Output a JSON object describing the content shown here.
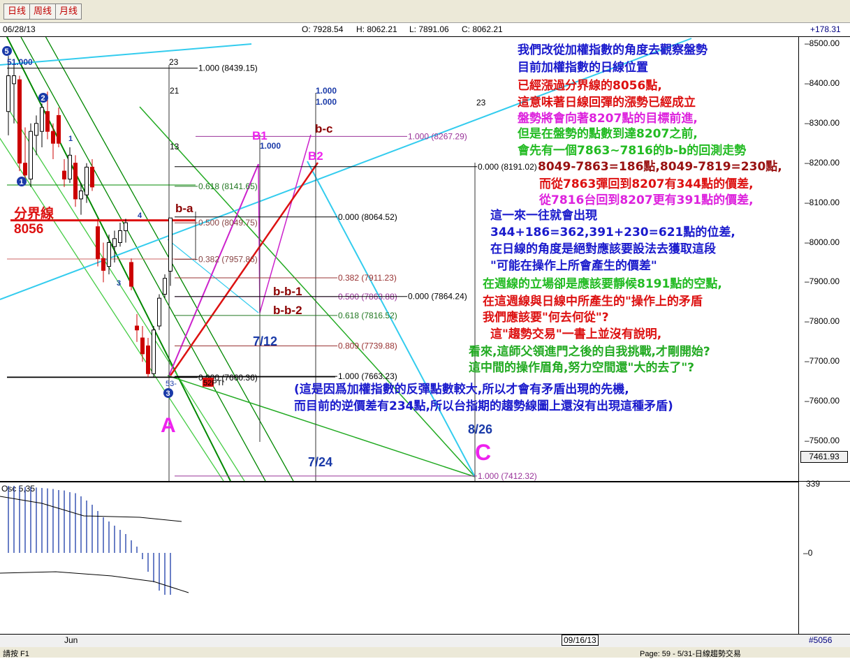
{
  "tabs": [
    {
      "label": "日线"
    },
    {
      "label": "周线"
    },
    {
      "label": "月线"
    }
  ],
  "header": {
    "date": "06/28/13",
    "open": "O: 7928.54",
    "high": "H: 8062.21",
    "low": "L: 7891.06",
    "close": "C: 8062.21",
    "change": "+178.31"
  },
  "price_axis": {
    "ticks": [
      "8500.00",
      "8400.00",
      "8300.00",
      "8200.00",
      "8100.00",
      "8000.00",
      "7900.00",
      "7800.00",
      "7700.00",
      "7600.00",
      "7500.00"
    ],
    "last_price": "7461.93"
  },
  "osc": {
    "label": "Osc 5,35",
    "axis_top": "339",
    "axis_zero": "0"
  },
  "bottom": {
    "month": "Jun",
    "date_marker": "09/16/13",
    "bar_number": "#5056"
  },
  "status": {
    "left": "請按 F1",
    "right": "Page: 59 - 5/31-日線趨勢交易"
  },
  "colors": {
    "up": "#000000",
    "down": "#cc0000",
    "channel": "#009900",
    "trend": "#33ccee",
    "magenta": "#cc22cc",
    "darkred": "#8b0000"
  },
  "chart_data": {
    "type": "candlestick",
    "ylim": [
      7412,
      8520
    ],
    "candles": [
      {
        "o": 8330,
        "h": 8470,
        "l": 8270,
        "c": 8420
      },
      {
        "o": 8400,
        "h": 8460,
        "l": 8300,
        "c": 8420
      },
      {
        "o": 8410,
        "h": 8420,
        "l": 8180,
        "c": 8200
      },
      {
        "o": 8200,
        "h": 8290,
        "l": 8150,
        "c": 8170
      },
      {
        "o": 8160,
        "h": 8300,
        "l": 8140,
        "c": 8280
      },
      {
        "o": 8270,
        "h": 8320,
        "l": 8220,
        "c": 8300
      },
      {
        "o": 8280,
        "h": 8350,
        "l": 8240,
        "c": 8340
      },
      {
        "o": 8330,
        "h": 8380,
        "l": 8260,
        "c": 8280
      },
      {
        "o": 8280,
        "h": 8300,
        "l": 8210,
        "c": 8250
      },
      {
        "o": 8320,
        "h": 8340,
        "l": 8240,
        "c": 8250
      },
      {
        "o": 8180,
        "h": 8210,
        "l": 8140,
        "c": 8160
      },
      {
        "o": 8160,
        "h": 8240,
        "l": 8150,
        "c": 8220
      },
      {
        "o": 8200,
        "h": 8220,
        "l": 8090,
        "c": 8110
      },
      {
        "o": 8110,
        "h": 8150,
        "l": 8070,
        "c": 8130
      },
      {
        "o": 8120,
        "h": 8200,
        "l": 8100,
        "c": 8190
      },
      {
        "o": 8190,
        "h": 8210,
        "l": 8130,
        "c": 8140
      },
      {
        "o": 8040,
        "h": 8060,
        "l": 7940,
        "c": 7960
      },
      {
        "o": 7960,
        "h": 8000,
        "l": 7900,
        "c": 7930
      },
      {
        "o": 7940,
        "h": 8020,
        "l": 7920,
        "c": 8000
      },
      {
        "o": 7990,
        "h": 8030,
        "l": 7950,
        "c": 8010
      },
      {
        "o": 8000,
        "h": 8050,
        "l": 7990,
        "c": 8030
      },
      {
        "o": 8030,
        "h": 8060,
        "l": 8000,
        "c": 8050
      },
      {
        "o": 7950,
        "h": 7960,
        "l": 7880,
        "c": 7890
      },
      {
        "o": 7790,
        "h": 7820,
        "l": 7750,
        "c": 7780
      },
      {
        "o": 7760,
        "h": 7790,
        "l": 7700,
        "c": 7720
      },
      {
        "o": 7740,
        "h": 7760,
        "l": 7660,
        "c": 7670
      },
      {
        "o": 7670,
        "h": 7790,
        "l": 7660,
        "c": 7780
      },
      {
        "o": 7790,
        "h": 7870,
        "l": 7780,
        "c": 7860
      },
      {
        "o": 7870,
        "h": 7920,
        "l": 7860,
        "c": 7910
      },
      {
        "o": 7928,
        "h": 8062,
        "l": 7891,
        "c": 8062
      }
    ],
    "osc_values": [
      320,
      320,
      318,
      315,
      315,
      312,
      310,
      308,
      305,
      300,
      298,
      290,
      285,
      270,
      250,
      230,
      200,
      170,
      150,
      130,
      110,
      90,
      60,
      30,
      -30,
      -90,
      -140,
      -180,
      -200,
      -200
    ],
    "fib_levels": [
      {
        "label": "1.000 (8439.15)",
        "value": 8439.15
      },
      {
        "label": "0.618 (8141.65)",
        "value": 8141.65
      },
      {
        "label": "0.500 (8049.75)",
        "value": 8049.75
      },
      {
        "label": "0.382 (7957.86)",
        "value": 7957.86
      },
      {
        "label": "0.000 (7660.36)",
        "value": 7660.36
      },
      {
        "label": "1.000 (8267.29)",
        "value": 8267.29
      },
      {
        "label": "0.000 (8191.02)",
        "value": 8191.02
      },
      {
        "label": "0.000 (8064.52)",
        "value": 8064.52
      },
      {
        "label": "0.382 (7911.23)",
        "value": 7911.23
      },
      {
        "label": "0.500 (7863.88)",
        "value": 7863.88
      },
      {
        "label": "0.618 (7816.52)",
        "value": 7816.52
      },
      {
        "label": "0.809 (7739.88)",
        "value": 7739.88
      },
      {
        "label": "1.000 (7663.23)",
        "value": 7663.23
      },
      {
        "label": "0.000 (7864.24)",
        "value": 7864.24
      },
      {
        "label": "1.000 (7412.32)",
        "value": 7412.32
      }
    ],
    "wave_labels": [
      "5",
      "2",
      "1",
      "3",
      "4",
      "A",
      "B1",
      "B2",
      "b-c",
      "b-a",
      "b-b-1",
      "b-b-2",
      "C"
    ],
    "count_labels": [
      "23",
      "21",
      "13",
      "23",
      "1.000",
      "1.000",
      "1.000",
      "51.000",
      "53-",
      "52PTI"
    ],
    "date_labels": [
      "7/12",
      "7/24",
      "8/26"
    ],
    "divider": {
      "label": "分界線",
      "value": "8056"
    }
  },
  "annotations": [
    {
      "text": "我們改從加權指數的角度去觀察盤勢",
      "color": "#1a1acc"
    },
    {
      "text": "目前加權指數的日線位置",
      "color": "#1a1acc"
    },
    {
      "text": "已經漲過分界線的8056點,",
      "color": "#dd1111"
    },
    {
      "text": "這意味著日線回彈的漲勢已經成立",
      "color": "#dd1111"
    },
    {
      "text": "盤勢將會向著8207點的目標前進,",
      "color": "#dd22dd"
    },
    {
      "text": "但是在盤勢的點數到達8207之前,",
      "color": "#22bb22"
    },
    {
      "text": "會先有一個7863~7816的b-b的回測走勢",
      "color": "#22bb22"
    },
    {
      "text": "8049-7863=186點,8049-7819=230點,",
      "color": "#991111"
    },
    {
      "text": "而從7863彈回到8207有344點的價差,",
      "color": "#dd1111"
    },
    {
      "text": "從7816台回到8207更有391點的價差,",
      "color": "#dd22dd"
    },
    {
      "text": "這一來一往就會出現",
      "color": "#1a1acc"
    },
    {
      "text": "344+186=362,391+230=621點的位差,",
      "color": "#1a1acc"
    },
    {
      "text": "在日線的角度是絕對應該要設法去獲取這段",
      "color": "#1a1acc"
    },
    {
      "text": "\"可能在操作上所會產生的價差\"",
      "color": "#1a1acc"
    },
    {
      "text": "在週線的立場卻是應該要靜候8191點的空點,",
      "color": "#22bb22"
    },
    {
      "text": "在這週線與日線中所產生的\"操作上的矛盾",
      "color": "#dd1111"
    },
    {
      "text": "我們應該要\"何去何從\"?",
      "color": "#dd1111"
    },
    {
      "text": "這\"趨勢交易\"一書上並沒有說明,",
      "color": "#dd1111"
    },
    {
      "text": "看來,這師父領進門之後的自我挑戰,才剛開始?",
      "color": "#22aa22"
    },
    {
      "text": "這中間的操作眉角,努力空間還\"大的去了\"?",
      "color": "#22aa22"
    },
    {
      "text": "(這是因爲加權指數的反彈點數較大,所以才會有矛盾出現的先機,",
      "color": "#1a1acc"
    },
    {
      "text": "而目前的逆價差有234點,所以台指期的趨勢線圖上還沒有出現這種矛盾)",
      "color": "#1a1acc"
    }
  ]
}
